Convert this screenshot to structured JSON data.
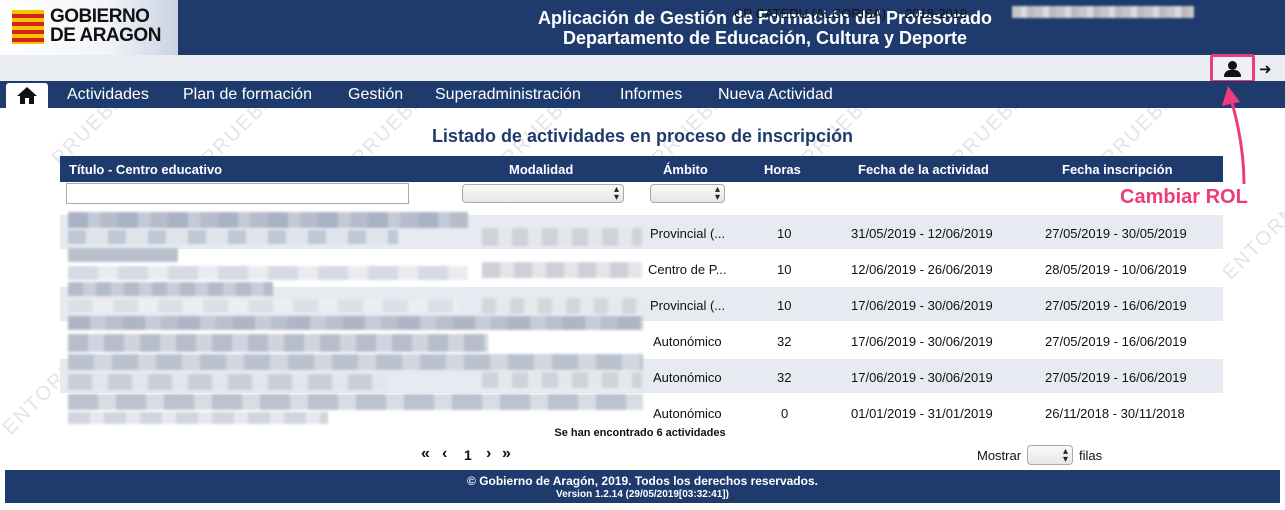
{
  "header": {
    "logo_line1": "GOBIERNO",
    "logo_line2": "DE ARAGON",
    "title_line1": "Aplicación de Gestión de Formación del Profesorado",
    "title_line2": "Departamento de Educación, Cultura y Deporte"
  },
  "infobar": {
    "center": "CP CATEDU (ALCORISA)",
    "year": "2018-2019",
    "user_icon": "user-icon",
    "logout_icon": "logout-icon"
  },
  "nav": {
    "home_icon": "home-icon",
    "items": [
      "Actividades",
      "Plan de formación",
      "Gestión",
      "Superadministración",
      "Informes",
      "Nueva Actividad"
    ]
  },
  "main": {
    "title": "Listado de actividades en proceso de inscripción",
    "columns": [
      "Título - Centro educativo",
      "Modalidad",
      "Ámbito",
      "Horas",
      "Fecha de la actividad",
      "Fecha inscripción"
    ],
    "rows": [
      {
        "ambito": "Provincial (...",
        "horas": "10",
        "fecha_actividad": "31/05/2019 - 12/06/2019",
        "fecha_inscripcion": "27/05/2019 - 30/05/2019"
      },
      {
        "ambito": "Centro de P...",
        "horas": "10",
        "fecha_actividad": "12/06/2019 - 26/06/2019",
        "fecha_inscripcion": "28/05/2019 - 10/06/2019"
      },
      {
        "ambito": "Provincial (...",
        "horas": "10",
        "fecha_actividad": "17/06/2019 - 30/06/2019",
        "fecha_inscripcion": "27/05/2019 - 16/06/2019"
      },
      {
        "ambito": "Autonómico",
        "horas": "32",
        "fecha_actividad": "17/06/2019 - 30/06/2019",
        "fecha_inscripcion": "27/05/2019 - 16/06/2019"
      },
      {
        "ambito": "Autonómico",
        "horas": "32",
        "fecha_actividad": "17/06/2019 - 30/06/2019",
        "fecha_inscripcion": "27/05/2019 - 16/06/2019"
      },
      {
        "ambito": "Autonómico",
        "horas": "0",
        "fecha_actividad": "01/01/2019 - 31/01/2019",
        "fecha_inscripcion": "26/11/2018 - 30/11/2018"
      }
    ],
    "found_text": "Se han encontrado 6 actividades",
    "pager": {
      "first": "«",
      "prev": "‹",
      "page": "1",
      "next": "›",
      "last": "»"
    },
    "show_label": "Mostrar",
    "rows_label": "filas"
  },
  "footer": {
    "copyright": "© Gobierno de Aragón, 2019. Todos los derechos reservados.",
    "version": "Version 1.2.14 (29/05/2019[03:32:41])"
  },
  "annotation": {
    "label": "Cambiar ROL",
    "color": "#ee3b7d"
  },
  "watermark": [
    "PRUEBAS",
    "ENTORNO"
  ],
  "colors": {
    "primary": "#1f3b6e",
    "alt_row": "#e7ebf1"
  }
}
